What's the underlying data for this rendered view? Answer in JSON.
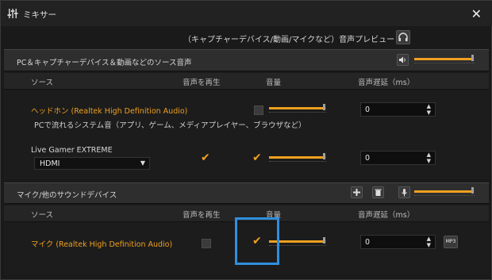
{
  "window": {
    "title": "ミキサー"
  },
  "preview": {
    "label": "（キャプチャーデバイス/動画/マイクなど）音声プレビュー"
  },
  "section_capture": {
    "title": "PC＆キャプチャーデバイス＆動画などのソース音声",
    "master_volume": 0.95
  },
  "capture_columns": {
    "source": "ソース",
    "play": "音声を再生",
    "volume": "音量",
    "delay": "音声遅延（ms）"
  },
  "capture_rows": [
    {
      "name": "ヘッドホン (Realtek High Definition Audio)",
      "desc": "PCで流れるシステム音（アプリ、ゲーム、メディアプレイヤー、ブラウザなど）",
      "play_checked": false,
      "volume": 0.95,
      "delay": "0"
    },
    {
      "name": "Live Gamer EXTREME",
      "dropdown_value": "HDMI",
      "play_checked": true,
      "volume_checked": true,
      "volume": 0.95,
      "delay": "0"
    }
  ],
  "section_mic": {
    "title": "マイク/他のサウンドデバイス",
    "master_volume": 0.95
  },
  "mic_columns": {
    "source": "ソース",
    "play": "音声を再生",
    "volume": "音量",
    "delay": "音声遅延（ms）"
  },
  "mic_rows": [
    {
      "name": "マイク (Realtek High Definition Audio)",
      "play_checked": false,
      "volume_checked": true,
      "volume": 0.95,
      "delay": "0",
      "mp3_label": "MP3"
    }
  ],
  "icons": {
    "title": "mixer-icon",
    "close": "close-icon",
    "headset": "headset-icon",
    "speaker": "speaker-icon",
    "plus": "plus-icon",
    "trash": "trash-icon",
    "mic": "microphone-icon"
  },
  "colors": {
    "accent": "#f0a020",
    "highlight": "#2f8fe0",
    "panel": "#1c1c1c",
    "header": "#2e2e2e"
  }
}
